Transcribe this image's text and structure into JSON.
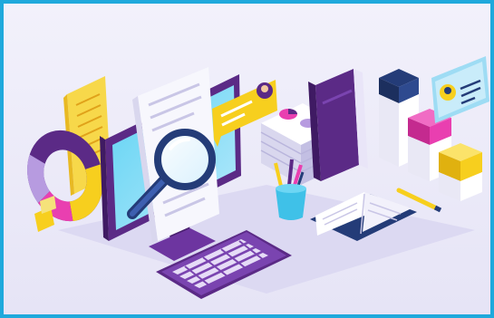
{
  "colors": {
    "frame_border": "#1fa9dc",
    "background": "#ebe9f8",
    "purple": "#5b2a86",
    "light_purple": "#b79be0",
    "yellow": "#f7cf1e",
    "magenta": "#e93fb0",
    "cyan": "#3fc1e8",
    "navy": "#243c78",
    "white": "#ffffff"
  },
  "icons": [
    "monitor-icon",
    "magnifier-icon",
    "document-icon",
    "donut-chart-icon",
    "keyboard-icon",
    "books-icon",
    "open-book-icon",
    "pencil-cup-icon",
    "cube-stack-icon",
    "profile-card-icon"
  ]
}
